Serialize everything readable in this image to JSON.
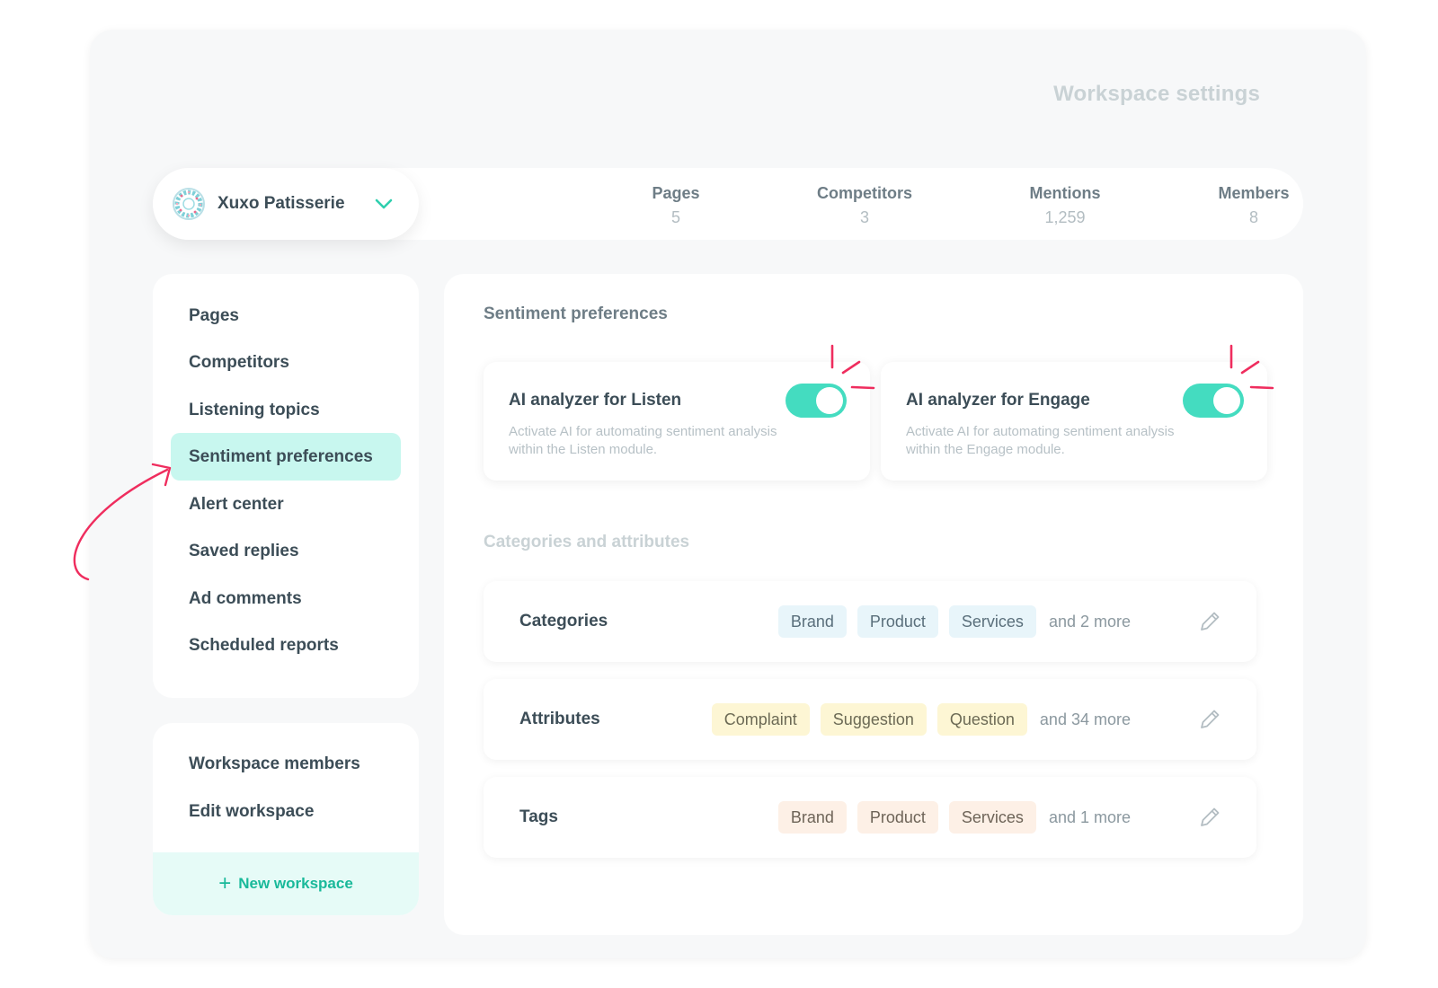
{
  "page": {
    "title": "Workspace settings"
  },
  "workspace": {
    "name": "Xuxo Patisserie",
    "logo_icon": "donut-logo-icon"
  },
  "stats": [
    {
      "label": "Pages",
      "value": "5"
    },
    {
      "label": "Competitors",
      "value": "3"
    },
    {
      "label": "Mentions",
      "value": "1,259"
    },
    {
      "label": "Members",
      "value": "8"
    }
  ],
  "sidebar": {
    "items": [
      {
        "label": "Pages"
      },
      {
        "label": "Competitors"
      },
      {
        "label": "Listening topics"
      },
      {
        "label": "Sentiment preferences",
        "active": true
      },
      {
        "label": "Alert center"
      },
      {
        "label": "Saved replies"
      },
      {
        "label": "Ad comments"
      },
      {
        "label": "Scheduled reports"
      }
    ],
    "secondary": [
      {
        "label": "Workspace members"
      },
      {
        "label": "Edit workspace"
      }
    ],
    "new_workspace": "New workspace"
  },
  "main": {
    "sentiment_title": "Sentiment preferences",
    "ai_cards": [
      {
        "title": "AI analyzer for Listen",
        "desc": "Activate AI for automating sentiment analysis within the Listen module.",
        "enabled": true
      },
      {
        "title": "AI analyzer for Engage",
        "desc": "Activate AI for automating sentiment analysis within the Engage module.",
        "enabled": true
      }
    ],
    "categories_title": "Categories and attributes",
    "rows": [
      {
        "label": "Categories",
        "chips": [
          "Brand",
          "Product",
          "Services"
        ],
        "more": "and 2 more"
      },
      {
        "label": "Attributes",
        "chips": [
          "Complaint",
          "Suggestion",
          "Question"
        ],
        "more": "and 34 more"
      },
      {
        "label": "Tags",
        "chips": [
          "Brand",
          "Product",
          "Services"
        ],
        "more": "and 1 more"
      }
    ]
  },
  "colors": {
    "accent": "#44dcc0",
    "active_nav": "#c8f7ef",
    "highlight": "#ef2d5e",
    "chip_blue": "#e8f5fa",
    "chip_yellow": "#fdf6d4",
    "chip_peach": "#fdf0e6"
  }
}
